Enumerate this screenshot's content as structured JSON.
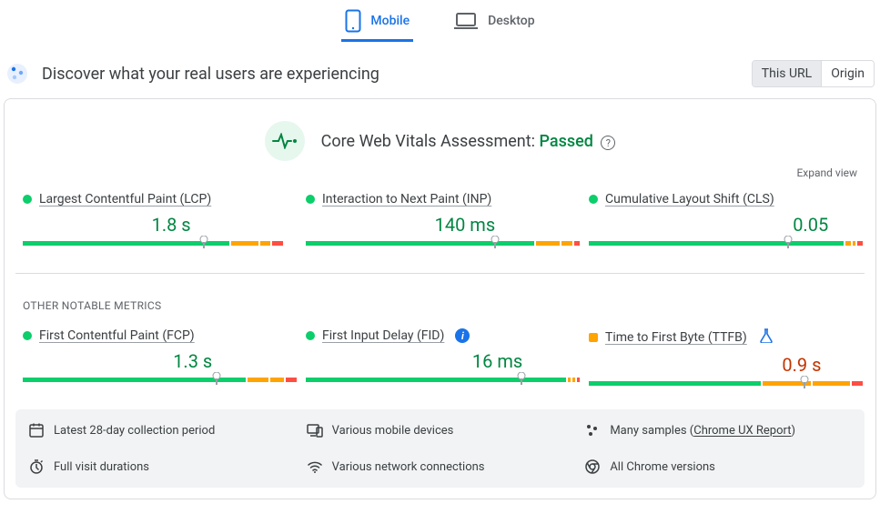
{
  "tabs": {
    "mobile": "Mobile",
    "desktop": "Desktop",
    "active": "mobile"
  },
  "header": {
    "title": "Discover what your real users are experiencing"
  },
  "toggle": {
    "this_url": "This URL",
    "origin": "Origin"
  },
  "assessment": {
    "prefix": "Core Web Vitals Assessment: ",
    "result": "Passed"
  },
  "expand": "Expand view",
  "section_other": "OTHER NOTABLE METRICS",
  "metrics": {
    "lcp": {
      "name": "Largest Contentful Paint (LCP)",
      "value": "1.8 s",
      "status": "good",
      "seg": [
        77,
        10,
        4,
        4
      ],
      "marker": 67,
      "value_pos": 48
    },
    "inp": {
      "name": "Interaction to Next Paint (INP)",
      "value": "140 ms",
      "status": "good",
      "seg": [
        85,
        9,
        4,
        2
      ],
      "marker": 70,
      "value_pos": 48
    },
    "cls": {
      "name": "Cumulative Layout Shift (CLS)",
      "value": "0.05",
      "status": "good",
      "seg": [
        95,
        2,
        1,
        2
      ],
      "marker": 74,
      "value_pos": 76
    },
    "fcp": {
      "name": "First Contentful Paint (FCP)",
      "value": "1.3 s",
      "status": "good",
      "seg": [
        83,
        8,
        5,
        4
      ],
      "marker": 72,
      "value_pos": 56
    },
    "fid": {
      "name": "First Input Delay (FID)",
      "value": "16 ms",
      "status": "good",
      "seg": [
        97,
        1,
        1,
        1
      ],
      "marker": 80,
      "value_pos": 62
    },
    "ttfb": {
      "name": "Time to First Byte (TTFB)",
      "value": "0.9 s",
      "status": "warn",
      "seg": [
        64,
        18,
        14,
        4
      ],
      "marker": 80,
      "value_pos": 72
    }
  },
  "footer": {
    "period": "Latest 28-day collection period",
    "devices": "Various mobile devices",
    "samples_prefix": "Many samples (",
    "samples_link": "Chrome UX Report",
    "samples_suffix": ")",
    "durations": "Full visit durations",
    "network": "Various network connections",
    "versions": "All Chrome versions"
  }
}
